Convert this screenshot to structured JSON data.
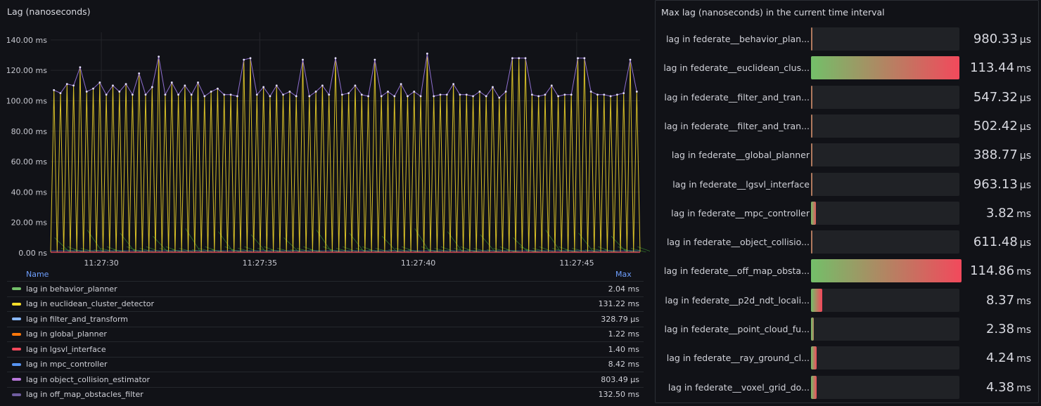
{
  "left_panel": {
    "title": "Lag (nanoseconds)"
  },
  "right_panel": {
    "title": "Max lag (nanoseconds) in the current time interval"
  },
  "legend": {
    "name_header": "Name",
    "max_header": "Max",
    "rows": [
      {
        "name": "lag in behavior_planner",
        "max": "2.04 ms",
        "color": "#73bf69"
      },
      {
        "name": "lag in euclidean_cluster_detector",
        "max": "131.22 ms",
        "color": "#fade2a"
      },
      {
        "name": "lag in filter_and_transform",
        "max": "328.79 µs",
        "color": "#8ab8ff"
      },
      {
        "name": "lag in global_planner",
        "max": "1.22 ms",
        "color": "#ff780a"
      },
      {
        "name": "lag in lgsvl_interface",
        "max": "1.40 ms",
        "color": "#f2495c"
      },
      {
        "name": "lag in mpc_controller",
        "max": "8.42 ms",
        "color": "#5794f2"
      },
      {
        "name": "lag in object_collision_estimator",
        "max": "803.49 µs",
        "color": "#b877d9"
      },
      {
        "name": "lag in off_map_obstacles_filter",
        "max": "132.50 ms",
        "color": "#705da0"
      }
    ]
  },
  "chart_data": [
    {
      "type": "line",
      "title": "Lag (nanoseconds)",
      "x_ticks": [
        "11:27:30",
        "11:27:35",
        "11:27:40",
        "11:27:45"
      ],
      "y_ticks": [
        "0.00 ns",
        "20.00 ms",
        "40.00 ms",
        "60.00 ms",
        "80.00 ms",
        "100.00 ms",
        "120.00 ms",
        "140.00 ms"
      ],
      "ylim_ms": [
        0,
        145
      ],
      "x_range_s": [
        0,
        18.6
      ],
      "series": [
        {
          "name": "lag in euclidean_cluster_detector",
          "color": "#fade2a",
          "peaks_ms": [
            107,
            105,
            111,
            110,
            122,
            106,
            108,
            112,
            104,
            110,
            106,
            111,
            104,
            118,
            104,
            109,
            129,
            104,
            112,
            104,
            110,
            104,
            112,
            103,
            106,
            108,
            104,
            104,
            103,
            127,
            128,
            104,
            109,
            103,
            110,
            104,
            106,
            103,
            127,
            103,
            106,
            110,
            104,
            128,
            104,
            105,
            110,
            104,
            103,
            127,
            103,
            106,
            103,
            111,
            103,
            106,
            103,
            131,
            103,
            104,
            104,
            111,
            104,
            104,
            103,
            106,
            103,
            109,
            102,
            106,
            128,
            128,
            128,
            104,
            103,
            104,
            110,
            103,
            104,
            104,
            128,
            128,
            106,
            104,
            104,
            103,
            104,
            105,
            127,
            106
          ],
          "grid": false
        },
        {
          "name": "lag in off_map_obstacles_filter",
          "color": "#705da0",
          "peaks_ms": [
            107,
            105,
            111,
            110,
            122,
            106,
            108,
            112,
            104,
            110,
            106,
            111,
            104,
            118,
            104,
            109,
            129,
            104,
            112,
            104,
            110,
            104,
            112,
            103,
            106,
            108,
            104,
            104,
            103,
            127,
            128,
            104,
            109,
            103,
            110,
            104,
            106,
            103,
            127,
            103,
            106,
            110,
            104,
            128,
            104,
            105,
            110,
            104,
            103,
            127,
            103,
            106,
            103,
            111,
            103,
            106,
            103,
            131,
            103,
            104,
            104,
            111,
            104,
            104,
            103,
            106,
            103,
            109,
            102,
            106,
            128,
            128,
            128,
            104,
            103,
            104,
            110,
            103,
            104,
            104,
            128,
            128,
            106,
            104,
            104,
            103,
            104,
            105,
            127,
            106
          ]
        }
      ]
    },
    {
      "type": "bar",
      "title": "Max lag (nanoseconds) in the current time interval",
      "orientation": "horizontal",
      "colors": [
        "#73bf69",
        "#f2495c"
      ],
      "max_scale_ms": 114.86,
      "items": [
        {
          "label": "lag in federate__behavior_plan...",
          "value_text": "980.33",
          "unit": "µs",
          "value_ms": 0.98033
        },
        {
          "label": "lag in federate__euclidean_clus...",
          "value_text": "113.44",
          "unit": "ms",
          "value_ms": 113.44
        },
        {
          "label": "lag in federate__filter_and_tran...",
          "value_text": "547.32",
          "unit": "µs",
          "value_ms": 0.54732
        },
        {
          "label": "lag in federate__filter_and_tran...",
          "value_text": "502.42",
          "unit": "µs",
          "value_ms": 0.50242
        },
        {
          "label": "lag in federate__global_planner",
          "value_text": "388.77",
          "unit": "µs",
          "value_ms": 0.38877
        },
        {
          "label": "lag in federate__lgsvl_interface",
          "value_text": "963.13",
          "unit": "µs",
          "value_ms": 0.96313
        },
        {
          "label": "lag in federate__mpc_controller",
          "value_text": "3.82",
          "unit": "ms",
          "value_ms": 3.82
        },
        {
          "label": "lag in federate__object_collisio...",
          "value_text": "611.48",
          "unit": "µs",
          "value_ms": 0.61148
        },
        {
          "label": "lag in federate__off_map_obsta...",
          "value_text": "114.86",
          "unit": "ms",
          "value_ms": 114.86
        },
        {
          "label": "lag in federate__p2d_ndt_locali...",
          "value_text": "8.37",
          "unit": "ms",
          "value_ms": 8.37
        },
        {
          "label": "lag in federate__point_cloud_fu...",
          "value_text": "2.38",
          "unit": "ms",
          "value_ms": 2.38
        },
        {
          "label": "lag in federate__ray_ground_cl...",
          "value_text": "4.24",
          "unit": "ms",
          "value_ms": 4.24
        },
        {
          "label": "lag in federate__voxel_grid_do...",
          "value_text": "4.38",
          "unit": "ms",
          "value_ms": 4.38
        }
      ]
    }
  ]
}
